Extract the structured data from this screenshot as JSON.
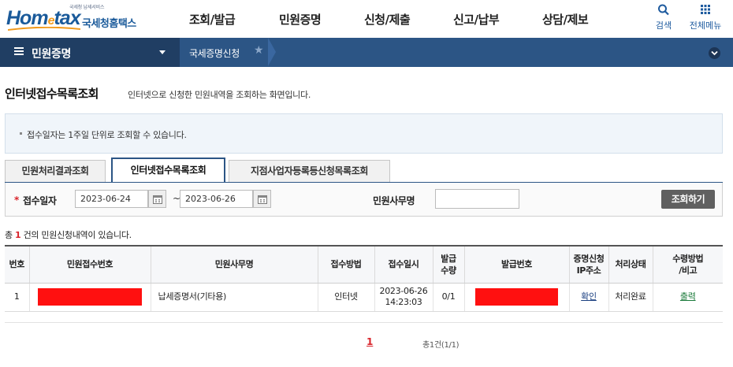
{
  "header": {
    "logo": {
      "tagline": "국세청 납세서비스",
      "brand_pre": "Hom",
      "brand_e": "e",
      "brand_post": "tax",
      "korean_name": "국세청홈택스"
    },
    "menu": [
      "조회/발급",
      "민원증명",
      "신청/제출",
      "신고/납부",
      "상담/제보"
    ],
    "search_label": "검색",
    "search_icon": "search-icon",
    "all_menu_label": "전체메뉴",
    "all_menu_icon": "grid-icon"
  },
  "navbar": {
    "section_title": "민원증명",
    "breadcrumb": "국세증명신청",
    "colors": {
      "bar": "#2c5585",
      "bar_dark": "#203e63"
    }
  },
  "page": {
    "title": "인터넷접수목록조회",
    "description": "인터넷으로 신청한 민원내역을 조회하는 화면입니다.",
    "notice": "접수일자는 1주일 단위로 조회할 수 있습니다."
  },
  "tabs": [
    {
      "label": "민원처리결과조회",
      "active": false
    },
    {
      "label": "인터넷접수목록조회",
      "active": true
    },
    {
      "label": "지점사업자등록등신청목록조회",
      "active": false
    }
  ],
  "search": {
    "required_mark": "*",
    "date_label": "접수일자",
    "date_from": "2023-06-24",
    "date_to": "2023-06-26",
    "range_sep": "~",
    "office_label": "민원사무명",
    "office_value": "",
    "submit_label": "조회하기"
  },
  "results": {
    "count_pre": "총 ",
    "count": "1",
    "count_post": " 건의 민원신청내역이 있습니다."
  },
  "table": {
    "headers": [
      "번호",
      "민원접수번호",
      "민원사무명",
      "접수방법",
      "접수일시",
      "발급\n수량",
      "발급번호",
      "증명신청\nIP주소",
      "처리상태",
      "수령방법\n/비고"
    ],
    "rows": [
      {
        "no": "1",
        "receipt_no": "",
        "office_name": "납세증명서(기타용)",
        "method": "인터넷",
        "date": "2023-06-26",
        "time": "14:23:03",
        "qty": "0/1",
        "issue_no": "",
        "ip": "확인",
        "status": "처리완료",
        "receive": "출력"
      }
    ]
  },
  "pager": {
    "current": "1",
    "total_text": "총1건(1/1)"
  }
}
